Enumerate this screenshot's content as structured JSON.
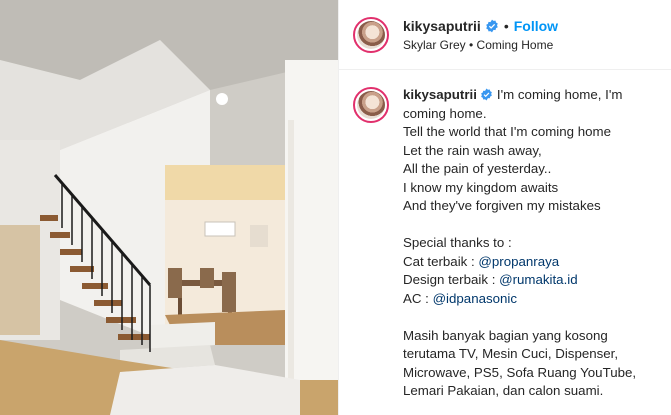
{
  "header": {
    "username": "kikysaputrii",
    "separator": "•",
    "follow_label": "Follow",
    "audio": "Skylar Grey • Coming Home"
  },
  "caption": {
    "username": "kikysaputrii",
    "lyrics": "I'm coming home, I'm coming home.\nTell the world that I'm coming home\nLet the rain wash away,\nAll the pain of yesterday..\nI know my kingdom awaits\nAnd they've forgiven my mistakes",
    "thanks_heading": "Special thanks to :",
    "credits": [
      {
        "label": "Cat terbaik : ",
        "mention": "@propanraya"
      },
      {
        "label": "Design terbaik : ",
        "mention": "@rumakita.id"
      },
      {
        "label": "AC : ",
        "mention": "@idpanasonic"
      }
    ],
    "closing": "Masih banyak bagian yang kosong terutama TV, Mesin Cuci, Dispenser, Microwave, PS5, Sofa Ruang YouTube, Lemari Pakaian, dan calon suami."
  },
  "colors": {
    "accent": "#0095f6",
    "mention": "#00376b",
    "verified": "#3897f0",
    "text": "#262626"
  },
  "icons": [
    "verified-badge-icon"
  ]
}
